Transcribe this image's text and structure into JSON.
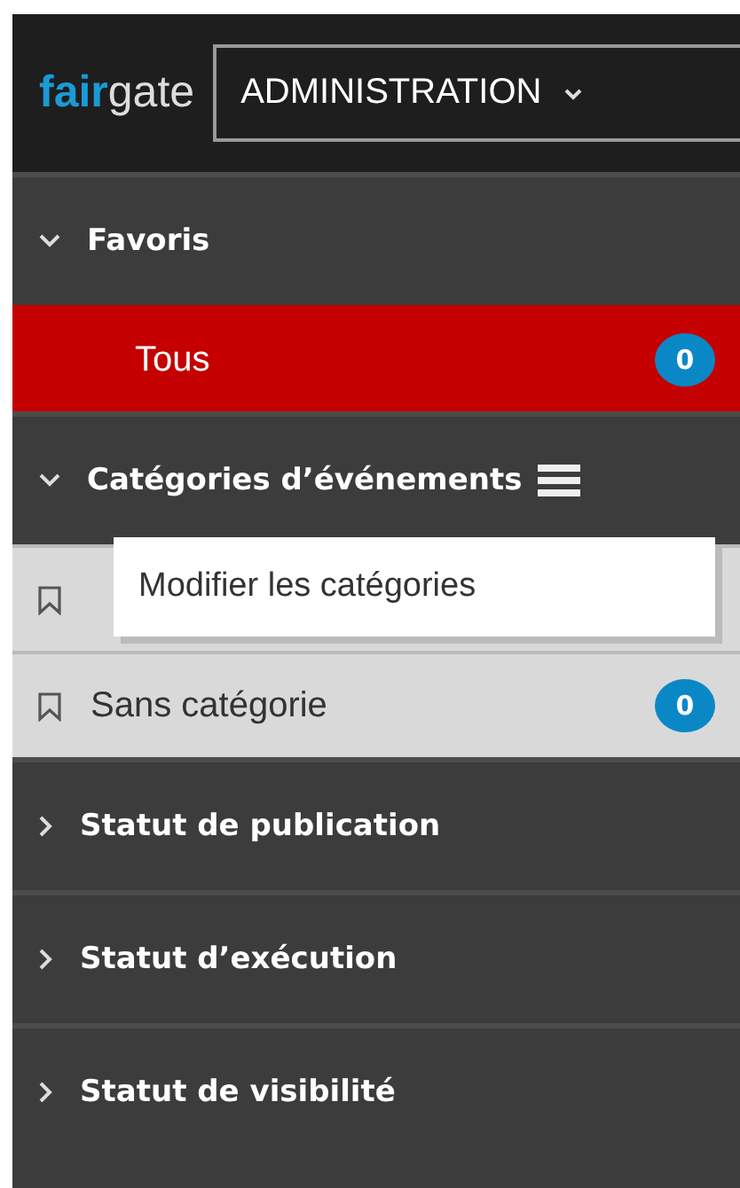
{
  "header": {
    "logo": {
      "part_1": "fair",
      "part_2": "gate"
    },
    "module_dropdown": {
      "label": "ADMINISTRATION"
    }
  },
  "sections": [
    {
      "title": "Favoris",
      "expanded": true,
      "items": [
        {
          "label": "Tous",
          "count": "0",
          "selected": true,
          "kind": "plain"
        }
      ]
    },
    {
      "title": "Catégories d’événements",
      "expanded": true,
      "menu": {
        "open": true,
        "items": [
          "Modifier les catégories"
        ]
      },
      "items": [
        {
          "kind": "bookmark",
          "selected": false
        },
        {
          "label": "Sans catégorie",
          "count": "0",
          "selected": false,
          "kind": "bookmark"
        }
      ]
    },
    {
      "title": "Statut de publication",
      "expanded": false
    },
    {
      "title": "Statut d’exécution",
      "expanded": false
    },
    {
      "title": "Statut de visibilité",
      "expanded": false
    }
  ]
}
